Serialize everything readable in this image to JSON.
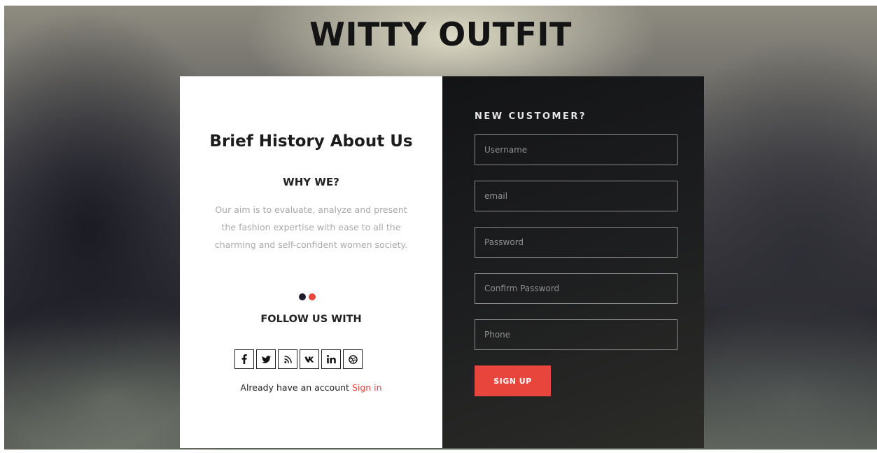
{
  "header": {
    "title": "WITTY OUTFIT"
  },
  "about": {
    "title": "Brief History About Us",
    "subheading": "WHY WE?",
    "text": "Our aim is to evaluate, analyze and present the fashion expertise with ease to all the charming and self-confident women society.",
    "carousel": {
      "total": 2,
      "active_index": 1
    },
    "follow_heading": "FOLLOW US WITH",
    "social_icons": [
      "facebook-icon",
      "twitter-icon",
      "rss-icon",
      "vk-icon",
      "linkedin-icon",
      "dribbble-icon"
    ],
    "account_prompt": "Already have an account",
    "signin_label": "Sign in"
  },
  "signup": {
    "heading": "NEW CUSTOMER?",
    "fields": {
      "username": {
        "placeholder": "Username"
      },
      "email": {
        "placeholder": "email"
      },
      "password": {
        "placeholder": "Password"
      },
      "confirm_password": {
        "placeholder": "Confirm Password"
      },
      "phone": {
        "placeholder": "Phone"
      }
    },
    "submit_label": "SIGN UP"
  },
  "colors": {
    "accent": "#e8453c",
    "dark_panel": "#1a1b1c",
    "dot_inactive": "#1c1c2e"
  }
}
